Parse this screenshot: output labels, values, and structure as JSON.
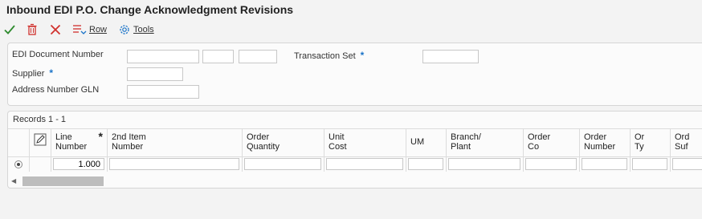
{
  "window": {
    "title": "Inbound EDI P.O. Change Acknowledgment Revisions"
  },
  "toolbar": {
    "ok_icon": "checkmark-icon",
    "delete_icon": "trash-icon",
    "cancel_icon": "x-icon",
    "row_label": "Row",
    "tools_label": "Tools"
  },
  "criteria": {
    "edi_doc_label": "EDI Document Number",
    "transaction_set_label": "Transaction Set",
    "supplier_label": "Supplier",
    "address_gln_label": "Address Number GLN",
    "required_marker": "*"
  },
  "grid": {
    "records_label": "Records 1 - 1",
    "required_marker": "*",
    "columns": [
      {
        "label_line1": "Line",
        "label_line2": "Number"
      },
      {
        "label_line1": "2nd Item",
        "label_line2": "Number"
      },
      {
        "label_line1": "Order",
        "label_line2": "Quantity"
      },
      {
        "label_line1": "Unit",
        "label_line2": "Cost"
      },
      {
        "label_line1": "UM",
        "label_line2": ""
      },
      {
        "label_line1": "Branch/",
        "label_line2": "Plant"
      },
      {
        "label_line1": "Order",
        "label_line2": "Co"
      },
      {
        "label_line1": "Order",
        "label_line2": "Number"
      },
      {
        "label_line1": "Or",
        "label_line2": "Ty"
      },
      {
        "label_line1": "Ord",
        "label_line2": "Suf"
      }
    ],
    "rows": [
      {
        "line_number": "1.000"
      }
    ]
  },
  "colors": {
    "accent": "#1a73c8",
    "ok": "#2e8b2e",
    "cancel": "#d0312d"
  }
}
